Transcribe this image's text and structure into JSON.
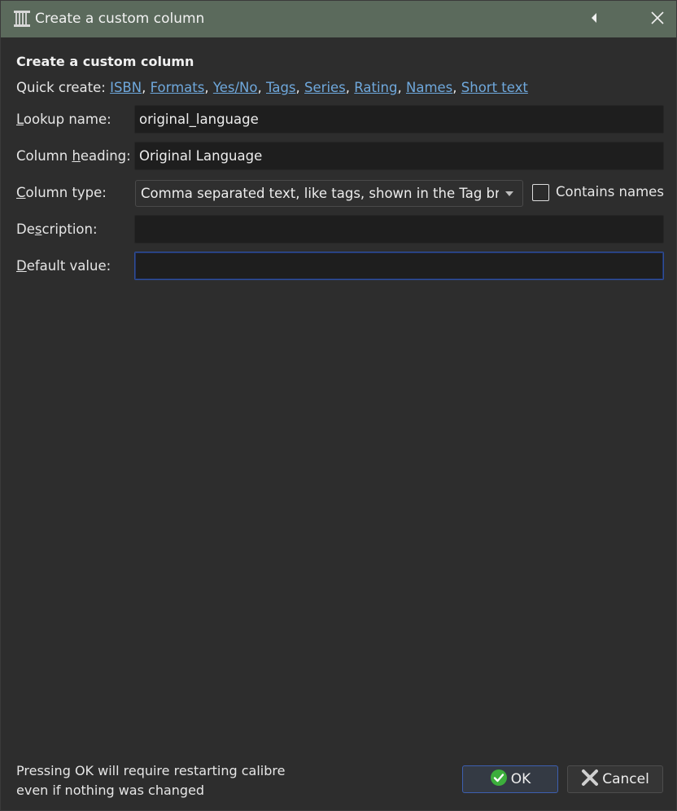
{
  "window": {
    "title": "Create a custom column"
  },
  "heading": "Create a custom column",
  "quick_create": {
    "label": "Quick create:",
    "links": [
      "ISBN",
      "Formats",
      "Yes/No",
      "Tags",
      "Series",
      "Rating",
      "Names",
      "Short text"
    ]
  },
  "form": {
    "lookup_name": {
      "label_accel": "L",
      "label_rest": "ookup name:",
      "value": "original_language"
    },
    "column_heading": {
      "label_pre": "Column ",
      "label_accel": "h",
      "label_rest": "eading:",
      "value": "Original Language"
    },
    "column_type": {
      "label_accel": "C",
      "label_rest": "olumn type:",
      "value": "Comma separated text, like tags, shown in the Tag browser"
    },
    "contains_names": {
      "label": "Contains names",
      "checked": false
    },
    "description": {
      "label_pre": "De",
      "label_accel": "s",
      "label_rest": "cription:",
      "value": ""
    },
    "default_value": {
      "label_accel": "D",
      "label_rest": "efault value:",
      "value": ""
    }
  },
  "footer": {
    "note_line1": "Pressing OK will require restarting calibre",
    "note_line2": "even if nothing was changed",
    "ok_label": "OK",
    "cancel_label": "Cancel"
  },
  "colors": {
    "titlebar": "#5b6a5c",
    "background": "#2d2d2d",
    "link": "#6fa8dc",
    "focus_border": "#2f4f9a"
  }
}
